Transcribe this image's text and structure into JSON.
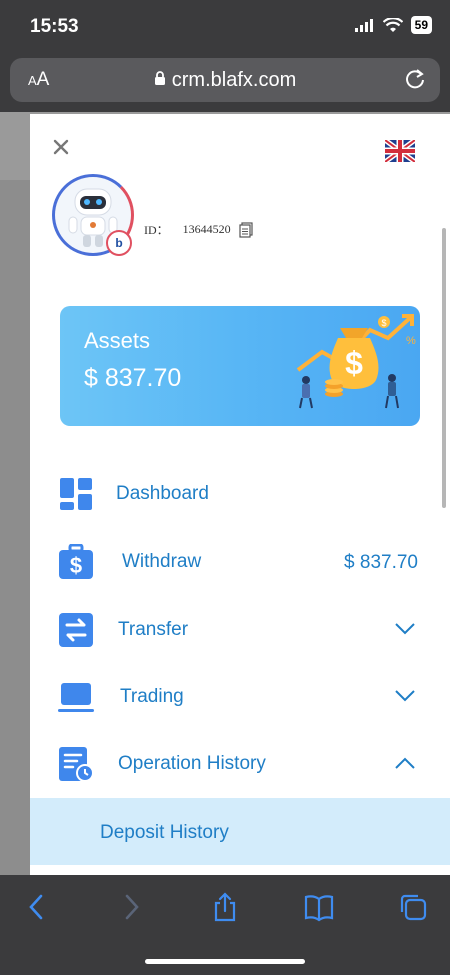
{
  "status_bar": {
    "time": "15:53",
    "battery": "59"
  },
  "browser": {
    "aa_large": "A",
    "aa_small": "A",
    "url": "crm.blafx.com"
  },
  "profile": {
    "id_label": "ID：",
    "id_value": "13644520"
  },
  "assets": {
    "label": "Assets",
    "value": "$ 837.70"
  },
  "menu": {
    "items": [
      {
        "label": "Dashboard",
        "icon": "dashboard-icon"
      },
      {
        "label": "Withdraw",
        "icon": "withdraw-wallet-icon",
        "amount": "$ 837.70"
      },
      {
        "label": "Transfer",
        "icon": "transfer-icon",
        "chevron": "down"
      },
      {
        "label": "Trading",
        "icon": "trading-laptop-icon",
        "chevron": "down"
      },
      {
        "label": "Operation History",
        "icon": "operation-history-icon",
        "chevron": "up"
      }
    ],
    "submenu": [
      {
        "label": "Deposit History"
      }
    ]
  },
  "colors": {
    "accent": "#1f7ec6",
    "icon_blue": "#3f87ec",
    "submenu_bg": "#d3ecfb",
    "card_start": "#6dc5f6",
    "card_end": "#4aa7f2"
  }
}
